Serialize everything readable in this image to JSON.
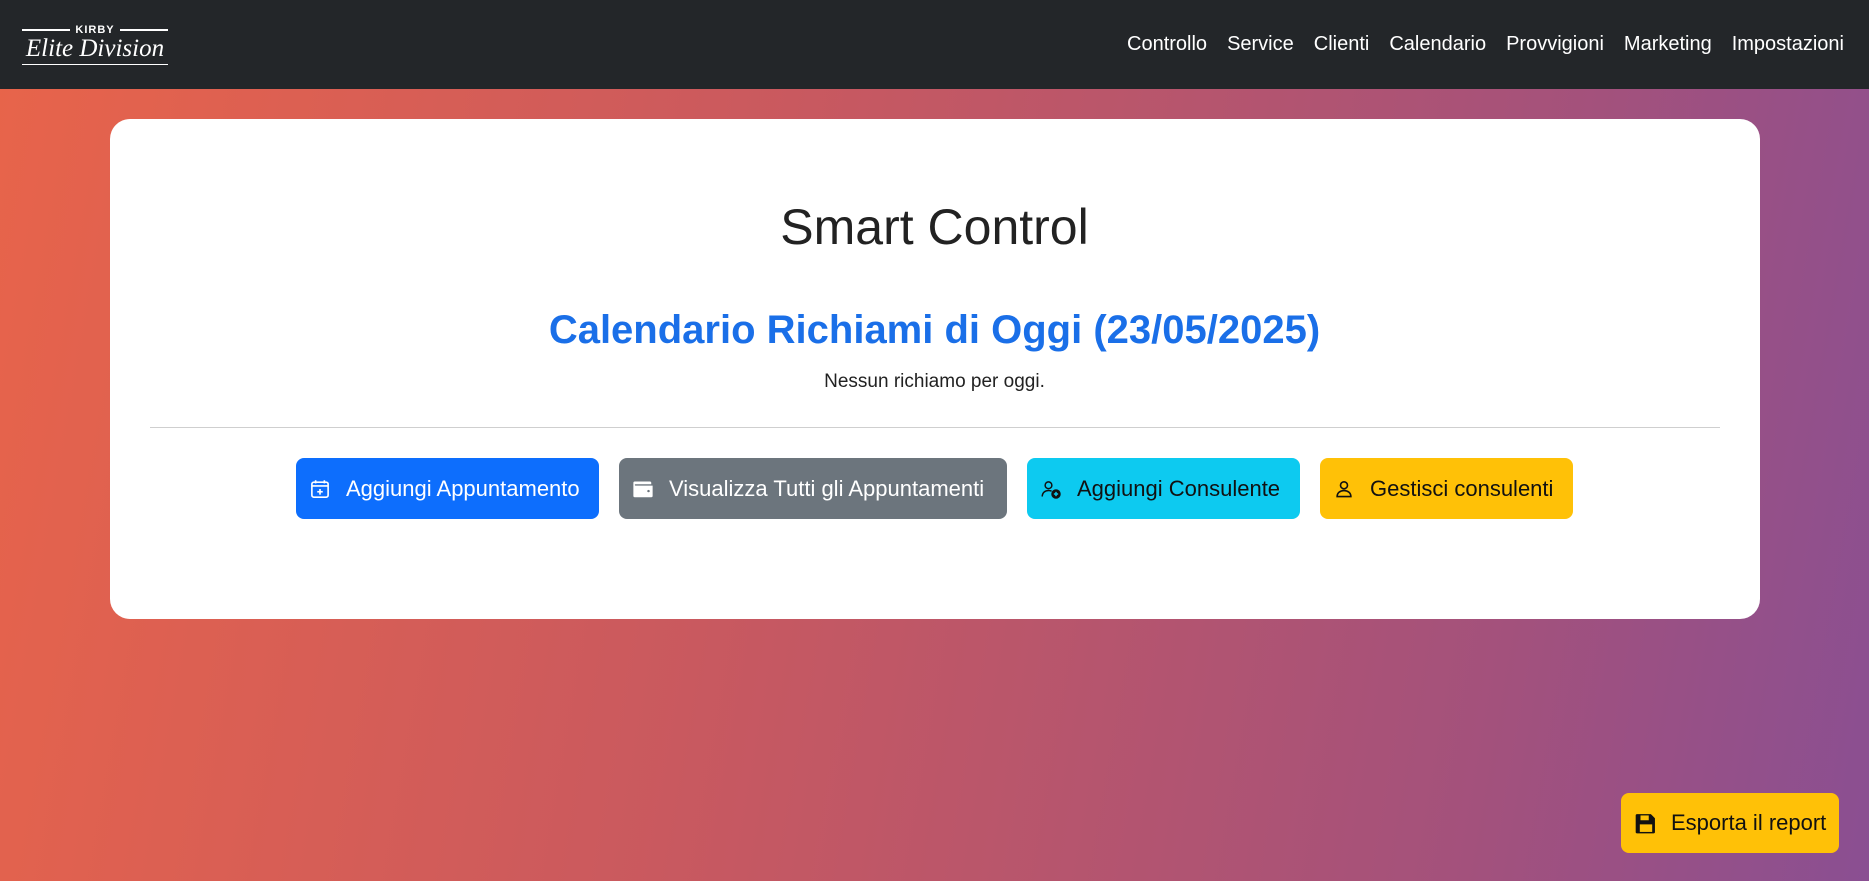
{
  "brand": {
    "top_text": "KIRBY",
    "script_text": "Elite Division"
  },
  "nav": {
    "items": [
      {
        "label": "Controllo"
      },
      {
        "label": "Service"
      },
      {
        "label": "Clienti"
      },
      {
        "label": "Calendario"
      },
      {
        "label": "Provvigioni"
      },
      {
        "label": "Marketing"
      },
      {
        "label": "Impostazioni"
      }
    ]
  },
  "main": {
    "title": "Smart Control",
    "callbacks_title": "Calendario Richiami di Oggi (23/05/2025)",
    "callbacks_empty": "Nessun richiamo per oggi.",
    "buttons": [
      {
        "label": "Aggiungi Appuntamento",
        "icon": "calendar-plus-icon",
        "color": "#0d6efd"
      },
      {
        "label": "Visualizza Tutti gli Appuntamenti",
        "icon": "wallet-icon",
        "color": "#6c757d"
      },
      {
        "label": "Aggiungi Consulente",
        "icon": "person-add-icon",
        "color": "#0dcaf0"
      },
      {
        "label": "Gestisci consulenti",
        "icon": "person-icon",
        "color": "#ffc107"
      }
    ]
  },
  "export": {
    "label": "Esporta il report",
    "icon": "floppy-disk-icon",
    "color": "#ffc107"
  },
  "colors": {
    "navbar": "#232629",
    "accent_blue": "#1a6fe8",
    "gradient_start": "#e8644a",
    "gradient_end": "#8a4f92"
  }
}
